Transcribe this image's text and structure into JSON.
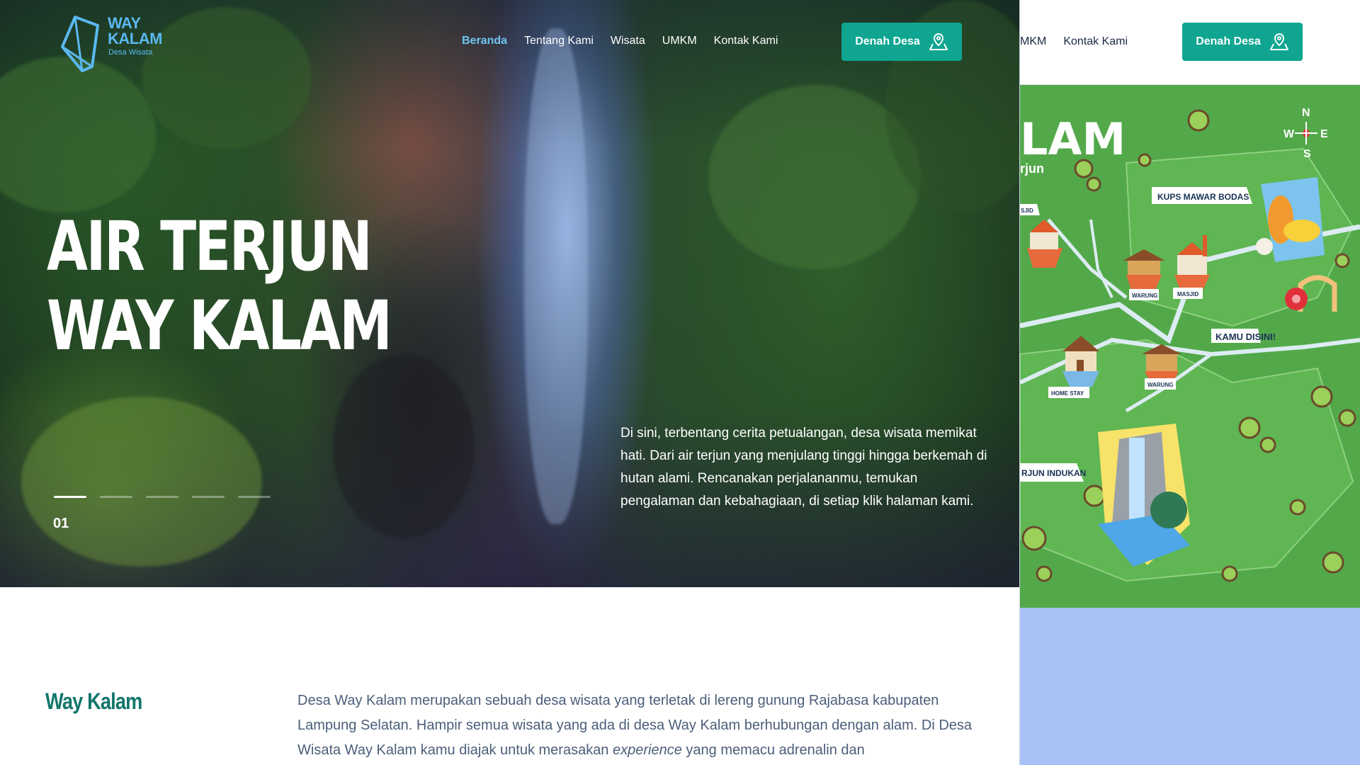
{
  "brand": {
    "name_line1": "WAY",
    "name_line2": "KALAM",
    "subtitle": "Desa Wisata"
  },
  "nav": {
    "items": [
      {
        "label": "Beranda",
        "active": true
      },
      {
        "label": "Tentang Kami",
        "active": false
      },
      {
        "label": "Wisata",
        "active": false
      },
      {
        "label": "UMKM",
        "active": false
      },
      {
        "label": "Kontak Kami",
        "active": false
      }
    ],
    "cta_label": "Denah Desa"
  },
  "nav_right": {
    "umkm_partial": "MKM",
    "contact": "Kontak Kami",
    "cta_label": "Denah Desa"
  },
  "hero": {
    "title_line1": "AIR TERJUN",
    "title_line2": "WAY KALAM",
    "slide_number": "01",
    "slide_count": 5,
    "active_slide": 1,
    "description": "Di sini, terbentang cerita petualangan, desa wisata memikat hati. Dari air terjun yang menjulang tinggi hingga berkemah di hutan alami. Rencanakan perjalananmu, temukan pengalaman dan kebahagiaan, di setiap klik halaman kami."
  },
  "about": {
    "title": "Way Kalam",
    "text_before": "Desa Way Kalam merupakan sebuah desa wisata yang terletak di lereng gunung Rajabasa kabupaten Lampung Selatan. Hampir semua wisata yang ada di desa Way Kalam berhubungan dengan alam. Di Desa Wisata Way Kalam kamu diajak untuk merasakan ",
    "text_emphasis": "experience",
    "text_after": " yang memacu adrenalin dan"
  },
  "map": {
    "title_partial": "LAM",
    "subtitle_partial": "rjun",
    "compass": {
      "n": "N",
      "w": "W",
      "e": "E",
      "s": "S"
    },
    "labels": {
      "kups": "KUPS MAWAR BODAS",
      "masjid_partial": "SJID",
      "warung1": "WARUNG",
      "masjid": "MASJID",
      "you_are_here": "KAMU DISINI!",
      "home_stay": "HOME STAY",
      "warung2": "WARUNG",
      "waterfall_partial": "RJUN INDUKAN"
    }
  },
  "colors": {
    "accent": "#0fa591",
    "nav_active": "#6ec6f2",
    "heading": "#12766b",
    "body_text": "#4c5e7a",
    "map_green": "#53a94a",
    "right_bg": "#a8c2f5"
  }
}
